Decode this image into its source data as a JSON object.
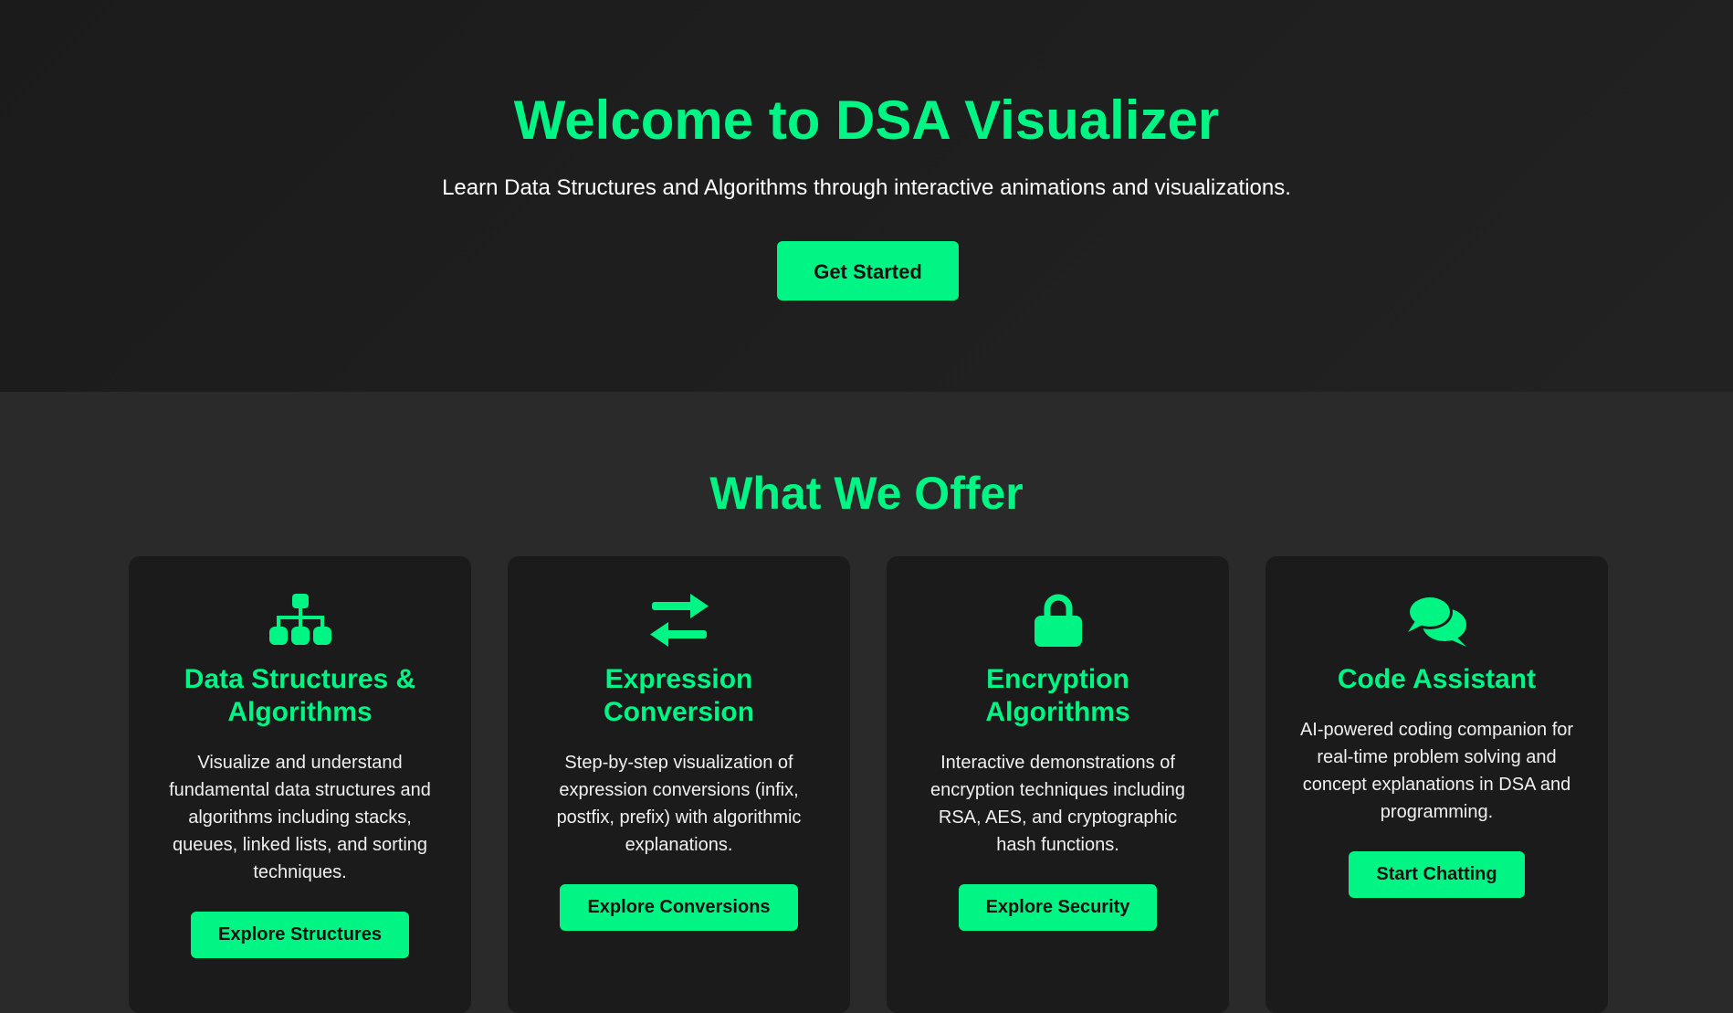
{
  "theme": {
    "accent": "#00f584",
    "hero_bg": "#1b1b1b",
    "section_bg": "#2a2a2a",
    "card_bg": "#1b1b1b"
  },
  "hero": {
    "title": "Welcome to DSA Visualizer",
    "subtitle": "Learn Data Structures and Algorithms through interactive animations and visualizations.",
    "cta_label": "Get Started"
  },
  "offer": {
    "title": "What We Offer",
    "cards": [
      {
        "icon": "sitemap-icon",
        "title": "Data Structures & Algorithms",
        "description": "Visualize and understand fundamental data structures and algorithms including stacks, queues, linked lists, and sorting techniques.",
        "button_label": "Explore Structures"
      },
      {
        "icon": "exchange-arrows-icon",
        "title": "Expression Conversion",
        "description": "Step-by-step visualization of expression conversions (infix, postfix, prefix) with algorithmic explanations.",
        "button_label": "Explore Conversions"
      },
      {
        "icon": "lock-icon",
        "title": "Encryption Algorithms",
        "description": "Interactive demonstrations of encryption techniques including RSA, AES, and cryptographic hash functions.",
        "button_label": "Explore Security"
      },
      {
        "icon": "chat-bubbles-icon",
        "title": "Code Assistant",
        "description": "AI-powered coding companion for real-time problem solving and concept explanations in DSA and programming.",
        "button_label": "Start Chatting"
      }
    ]
  }
}
